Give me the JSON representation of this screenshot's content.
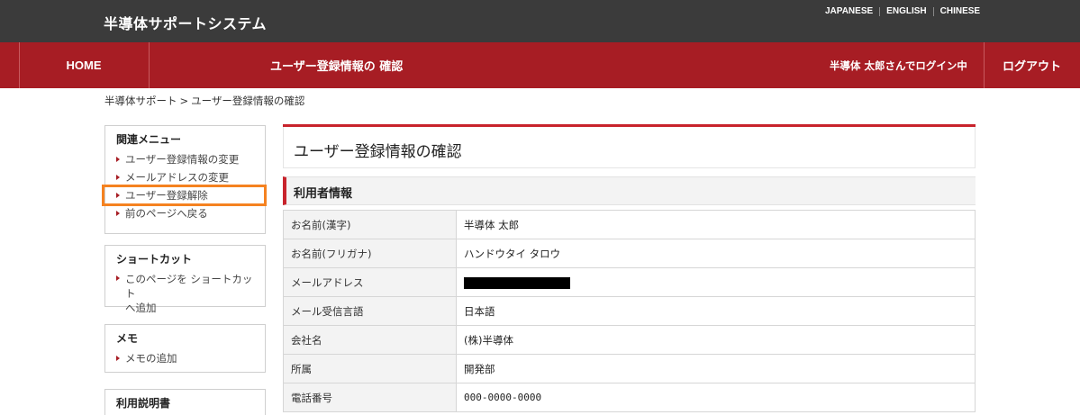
{
  "header": {
    "site_title": "半導体サポートシステム",
    "languages": [
      "JAPANESE",
      "ENGLISH",
      "CHINESE"
    ]
  },
  "nav": {
    "home": "HOME",
    "page_title": "ユーザー登録情報の 確認",
    "login_status": "半導体 太郎さんでログイン中",
    "logout": "ログアウト"
  },
  "breadcrumb": {
    "root": "半導体サポート",
    "separator": ">",
    "current": "ユーザー登録情報の確認"
  },
  "sidebar": {
    "related_menu": {
      "title": "関連メニュー",
      "items": [
        "ユーザー登録情報の変更",
        "メールアドレスの変更",
        "ユーザー登録解除",
        "前のページへ戻る"
      ]
    },
    "shortcut": {
      "title": "ショートカット",
      "item_line1": "このページを ショートカット",
      "item_line2": "へ追加"
    },
    "memo": {
      "title": "メモ",
      "item": "メモの追加"
    },
    "manual": {
      "title": "利用説明書"
    }
  },
  "main": {
    "title": "ユーザー登録情報の確認",
    "section_title": "利用者情報",
    "rows": [
      {
        "label": "お名前(漢字)",
        "value": "半導体 太郎"
      },
      {
        "label": "お名前(フリガナ)",
        "value": "ハンドウタイ タロウ"
      },
      {
        "label": "メールアドレス",
        "value": ""
      },
      {
        "label": "メール受信言語",
        "value": "日本語"
      },
      {
        "label": "会社名",
        "value": "(株)半導体"
      },
      {
        "label": "所属",
        "value": "開発部"
      },
      {
        "label": "電話番号",
        "value": "000-0000-0000"
      }
    ]
  },
  "colors": {
    "nav_red": "#a71d24",
    "accent_red": "#c8232c",
    "highlight_orange": "#f58220",
    "topbar": "#3b3b3b"
  }
}
